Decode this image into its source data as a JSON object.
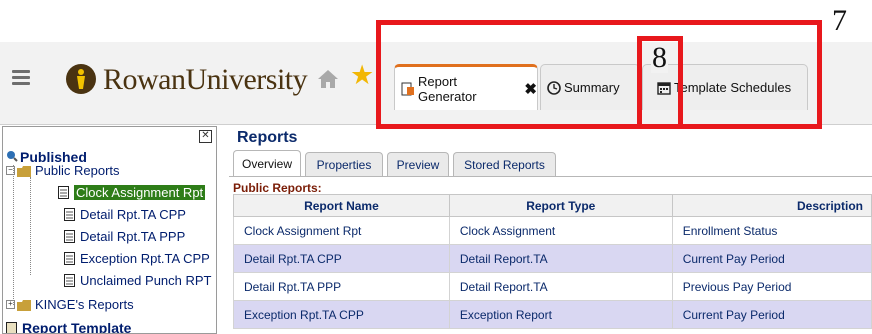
{
  "annotations": {
    "outer_number": "7",
    "inner_number": "8"
  },
  "header": {
    "brand": "RowanUniversity",
    "tabs": [
      {
        "label": "Report Generator",
        "icon": "report-icon",
        "closable": true
      },
      {
        "label": "Summary",
        "icon": "clock-icon"
      },
      {
        "label": "Template Schedules",
        "icon": "calendar-icon"
      }
    ]
  },
  "tree": {
    "published": "Published",
    "public_reports": "Public Reports",
    "items": [
      "Clock Assignment Rpt",
      "Detail Rpt.TA CPP",
      "Detail Rpt.TA PPP",
      "Exception Rpt.TA CPP",
      "Unclaimed Punch RPT"
    ],
    "kinge": "KINGE's Reports",
    "report_template": "Report Template"
  },
  "main": {
    "title": "Reports",
    "tabs": [
      "Overview",
      "Properties",
      "Preview",
      "Stored Reports"
    ],
    "section_label": "Public Reports:",
    "columns": [
      "Report Name",
      "Report Type",
      "Description"
    ],
    "rows": [
      [
        "Clock Assignment Rpt",
        "Clock Assignment",
        "Enrollment Status"
      ],
      [
        "Detail Rpt.TA CPP",
        "Detail Report.TA",
        "Current Pay Period"
      ],
      [
        "Detail Rpt.TA PPP",
        "Detail Report.TA",
        "Previous Pay Period"
      ],
      [
        "Exception Rpt.TA CPP",
        "Exception Report",
        "Current Pay Period"
      ]
    ]
  },
  "colors": {
    "annotation": "#e8181c",
    "brand": "#4a3311",
    "active_tab_accent": "#e0701e",
    "selected_tree": "#2e7d18",
    "alt_row": "#d9d7f2"
  }
}
